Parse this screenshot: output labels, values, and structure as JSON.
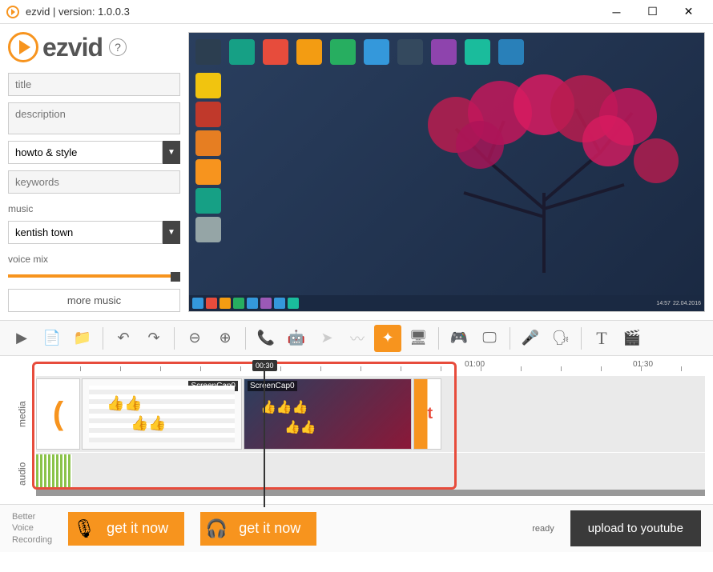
{
  "window": {
    "title": "ezvid | version: 1.0.0.3"
  },
  "logo": {
    "text": "ezvid"
  },
  "fields": {
    "title_placeholder": "title",
    "description_placeholder": "description",
    "category_value": "howto & style",
    "keywords_placeholder": "keywords",
    "music_label": "music",
    "music_value": "kentish town",
    "voice_mix_label": "voice mix",
    "more_music": "more music"
  },
  "timeline": {
    "playhead_time": "00:30",
    "marks": [
      "01:00",
      "01:30"
    ],
    "clips": [
      {
        "label": "ScreenCap0"
      },
      {
        "label": "ScreenCap0"
      }
    ],
    "track_media": "media",
    "track_audio": "audio"
  },
  "bottom": {
    "better_voice": "Better\nVoice\nRecording",
    "get_it_now": "get it now",
    "ready": "ready",
    "upload": "upload to youtube"
  },
  "preview": {
    "taskbar_time": "14:57",
    "taskbar_date": "22.04.2016"
  }
}
